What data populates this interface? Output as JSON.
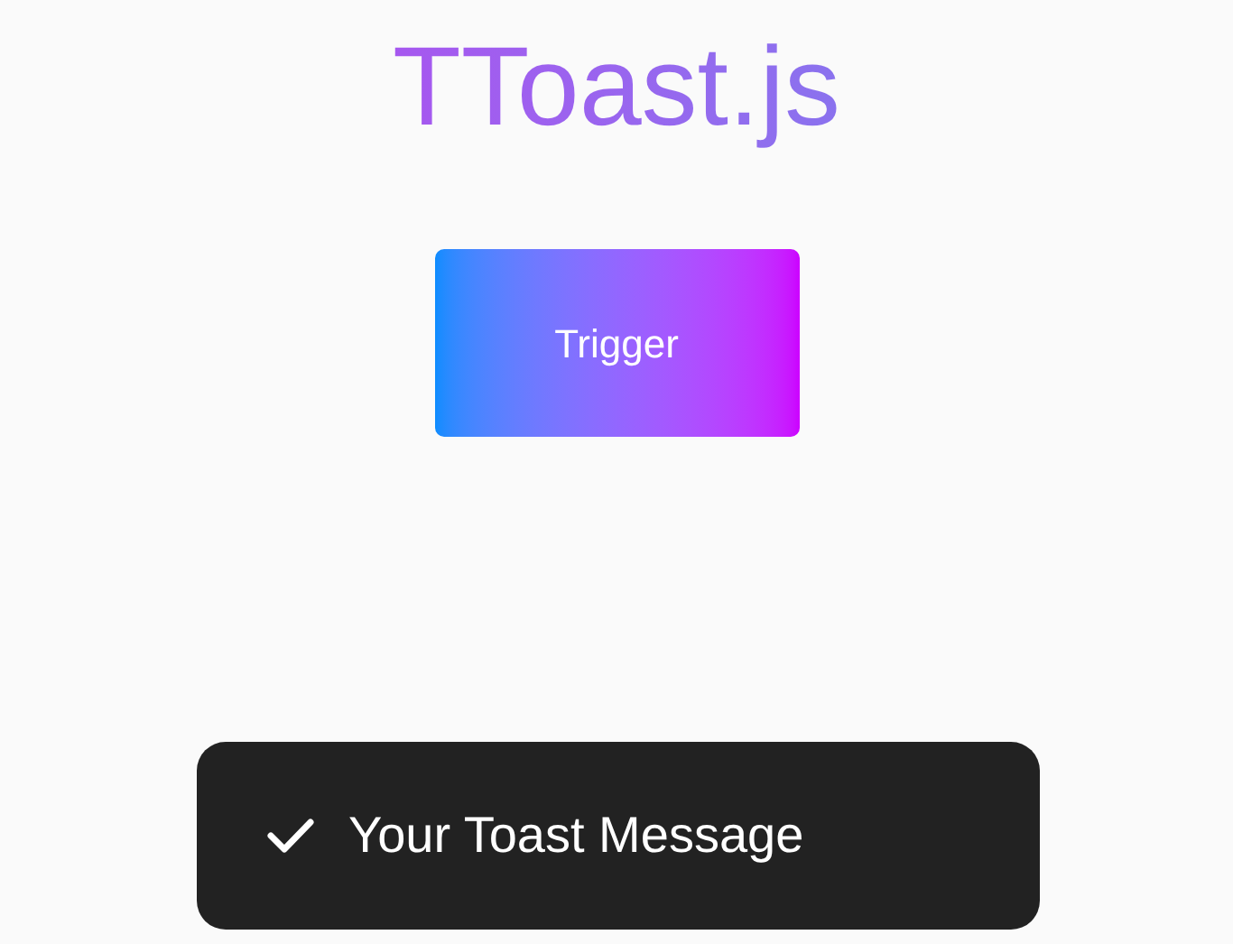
{
  "title": "TToast.js",
  "trigger_button": {
    "label": "Trigger"
  },
  "toast": {
    "kind": "success",
    "message": "Your Toast Message"
  }
}
